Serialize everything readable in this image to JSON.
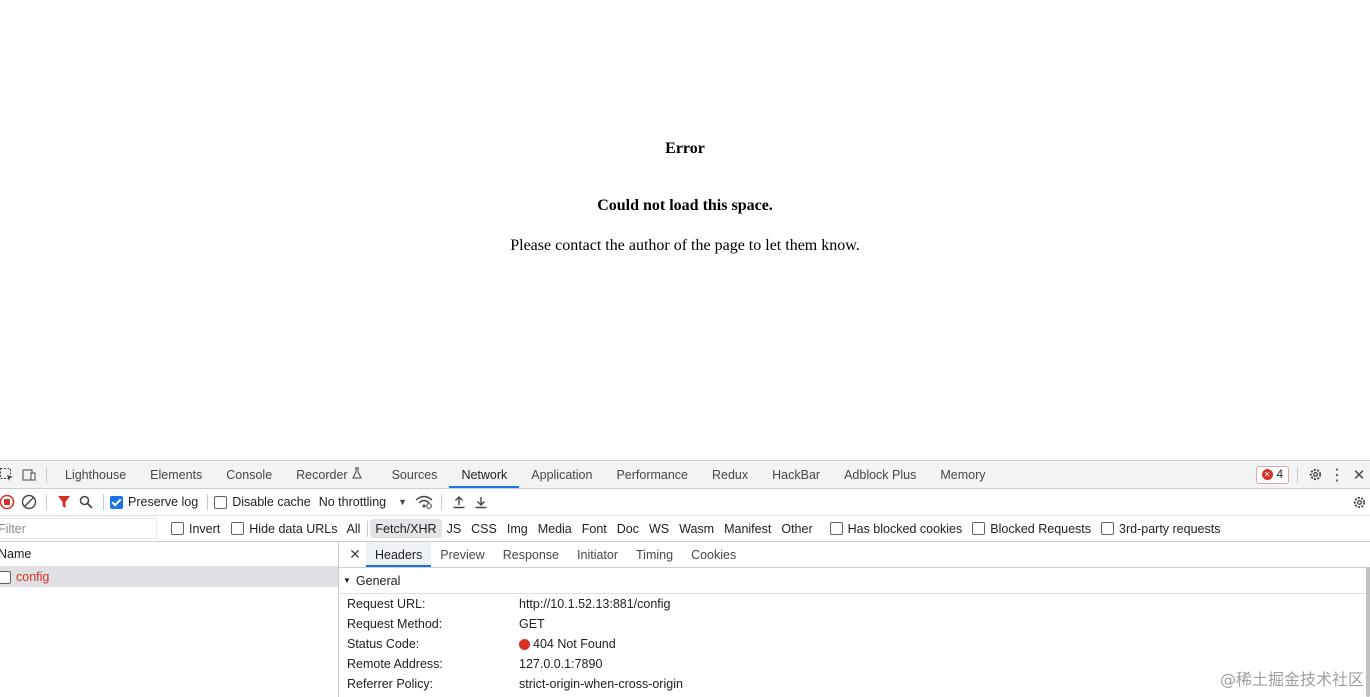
{
  "page": {
    "error_title": "Error",
    "error_heading": "Could not load this space.",
    "error_message": "Please contact the author of the page to let them know."
  },
  "devtools": {
    "tabs": [
      "Lighthouse",
      "Elements",
      "Console",
      "Recorder",
      "Sources",
      "Network",
      "Application",
      "Performance",
      "Redux",
      "HackBar",
      "Adblock Plus",
      "Memory"
    ],
    "active_tab": "Network",
    "error_count": "4",
    "toolbar": {
      "preserve_log_label": "Preserve log",
      "preserve_log_checked": true,
      "disable_cache_label": "Disable cache",
      "disable_cache_checked": false,
      "throttling_value": "No throttling"
    },
    "filterbar": {
      "filter_placeholder": "Filter",
      "invert_label": "Invert",
      "hide_data_urls_label": "Hide data URLs",
      "types": [
        "All",
        "Fetch/XHR",
        "JS",
        "CSS",
        "Img",
        "Media",
        "Font",
        "Doc",
        "WS",
        "Wasm",
        "Manifest",
        "Other"
      ],
      "active_type": "Fetch/XHR",
      "has_blocked_cookies_label": "Has blocked cookies",
      "blocked_requests_label": "Blocked Requests",
      "third_party_label": "3rd-party requests"
    },
    "request_list": {
      "column_name": "Name",
      "items": [
        {
          "name": "config",
          "status": "error"
        }
      ]
    },
    "details": {
      "tabs": [
        "Headers",
        "Preview",
        "Response",
        "Initiator",
        "Timing",
        "Cookies"
      ],
      "active_tab": "Headers",
      "section_title": "General",
      "rows": [
        {
          "key": "Request URL:",
          "value": "http://10.1.52.13:881/config"
        },
        {
          "key": "Request Method:",
          "value": "GET"
        },
        {
          "key": "Status Code:",
          "value": "404 Not Found"
        },
        {
          "key": "Remote Address:",
          "value": "127.0.0.1:7890"
        },
        {
          "key": "Referrer Policy:",
          "value": "strict-origin-when-cross-origin"
        }
      ]
    }
  },
  "watermark": "@稀土掘金技术社区",
  "colors": {
    "accent": "#1a73e8",
    "error": "#d93025"
  }
}
